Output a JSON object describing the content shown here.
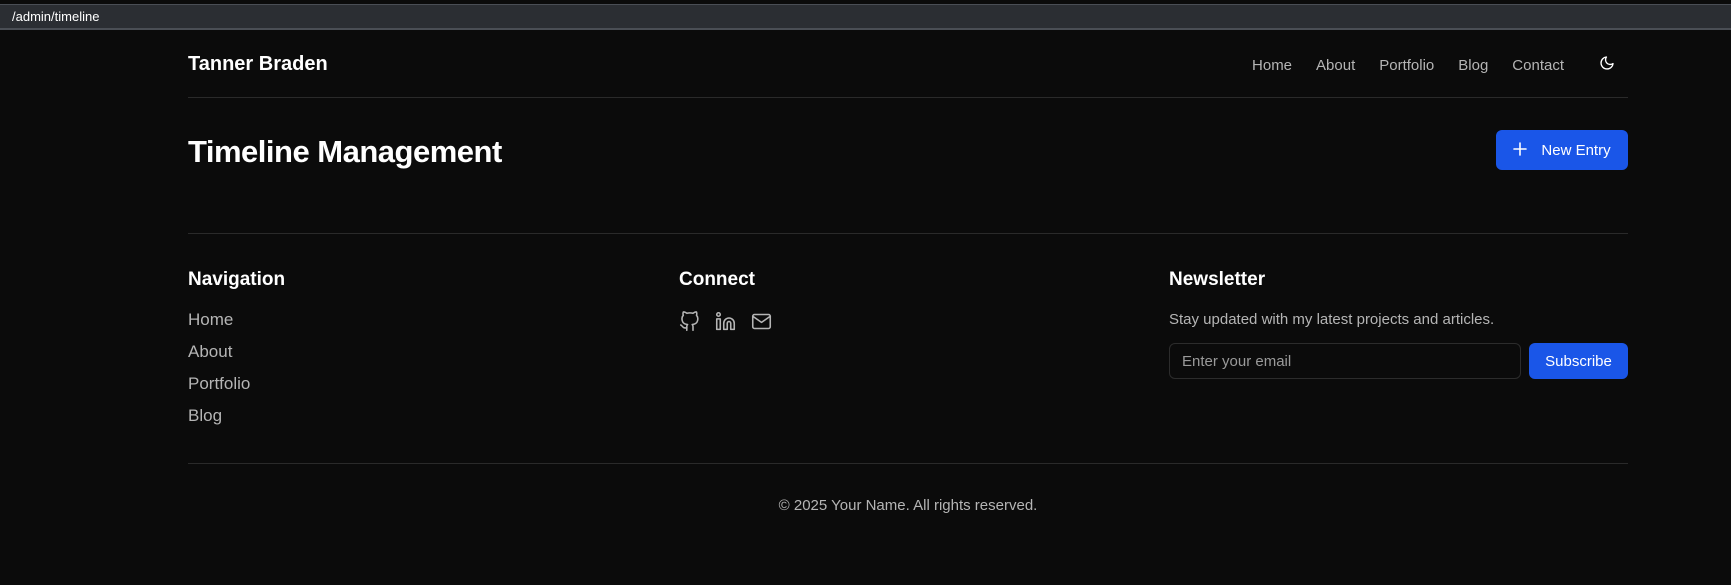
{
  "browser": {
    "url": "/admin/timeline"
  },
  "header": {
    "brand": "Tanner Braden",
    "nav": [
      "Home",
      "About",
      "Portfolio",
      "Blog",
      "Contact"
    ],
    "theme_icon": "moon-icon"
  },
  "main": {
    "title": "Timeline Management",
    "new_entry_label": "New Entry",
    "new_entry_icon": "plus-icon"
  },
  "footer": {
    "navigation": {
      "heading": "Navigation",
      "links": [
        "Home",
        "About",
        "Portfolio",
        "Blog"
      ]
    },
    "connect": {
      "heading": "Connect",
      "icons": [
        "github-icon",
        "linkedin-icon",
        "mail-icon"
      ]
    },
    "newsletter": {
      "heading": "Newsletter",
      "description": "Stay updated with my latest projects and articles.",
      "email_placeholder": "Enter your email",
      "email_value": "",
      "subscribe_label": "Subscribe"
    },
    "copyright": "© 2025 Your Name. All rights reserved."
  },
  "colors": {
    "background": "#0b0b0b",
    "accent": "#1a56e8",
    "muted_text": "#b5b5b5",
    "divider": "#2a2a2a"
  }
}
